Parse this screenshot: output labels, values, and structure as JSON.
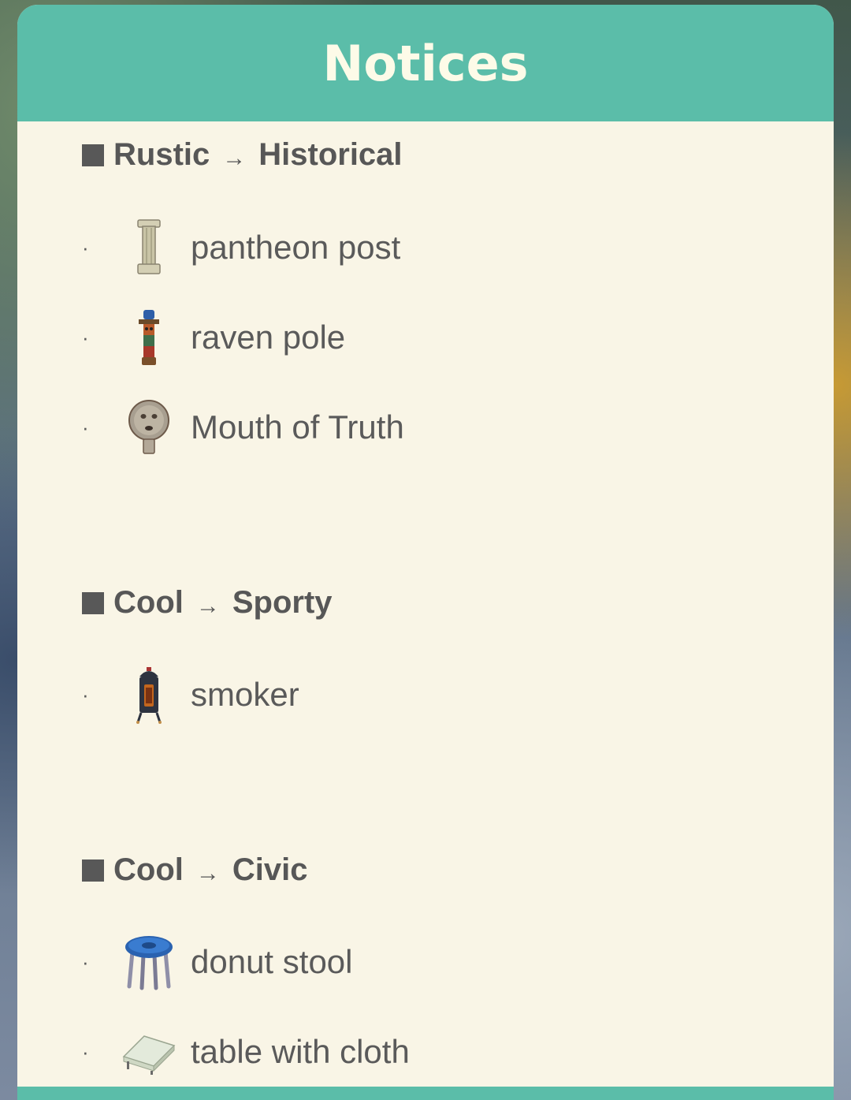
{
  "header": {
    "title": "Notices"
  },
  "sections": [
    {
      "from": "Rustic",
      "arrow": "→",
      "to": "Historical",
      "items": [
        {
          "label": "pantheon post",
          "icon": "pantheon-post-icon"
        },
        {
          "label": "raven pole",
          "icon": "raven-pole-icon"
        },
        {
          "label": "Mouth of Truth",
          "icon": "mouth-of-truth-icon"
        }
      ]
    },
    {
      "from": "Cool",
      "arrow": "→",
      "to": "Sporty",
      "items": [
        {
          "label": "smoker",
          "icon": "smoker-icon"
        }
      ]
    },
    {
      "from": "Cool",
      "arrow": "→",
      "to": "Civic",
      "items": [
        {
          "label": "donut stool",
          "icon": "donut-stool-icon"
        },
        {
          "label": "table with cloth",
          "icon": "table-with-cloth-icon"
        }
      ]
    }
  ],
  "bullet": "·",
  "colors": {
    "header_bg": "#5bbda9",
    "panel_bg": "#f9f5e6",
    "title_text": "#fdfbe8",
    "body_text": "#5a5a5a"
  }
}
